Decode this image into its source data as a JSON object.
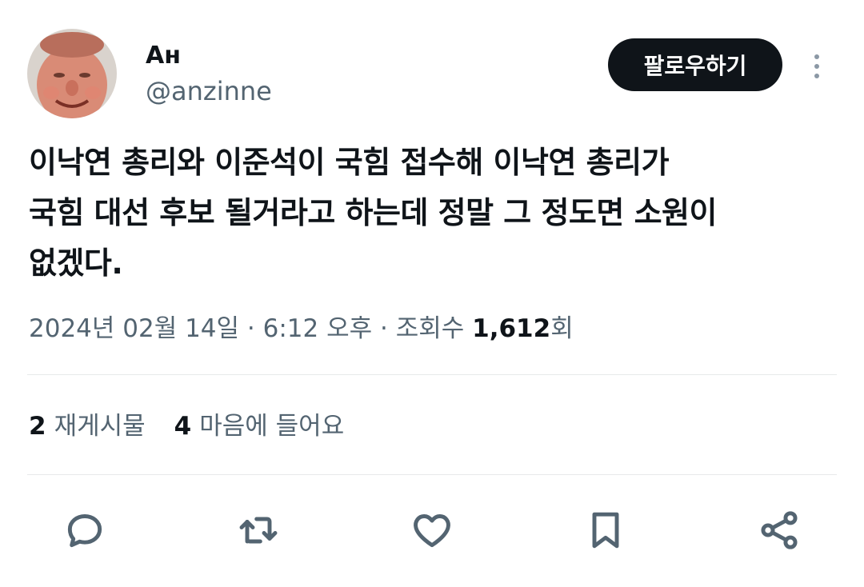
{
  "author": {
    "display_name": "Ан",
    "handle": "@anzinne",
    "avatar_icon": "user-avatar-photo"
  },
  "header": {
    "follow_label": "팔로우하기",
    "more_icon": "more-vertical-icon"
  },
  "tweet": {
    "text": "이낙연 총리와 이준석이 국힘 접수해 이낙연 총리가\n국힘 대선 후보 될거라고 하는데 정말 그 정도면 소원이\n없겠다."
  },
  "meta": {
    "date": "2024년 02월 14일",
    "separator1": " · ",
    "time": "6:12 오후",
    "separator2": " · ",
    "views_label": "조회수 ",
    "views_count": "1,612",
    "views_suffix": "회"
  },
  "stats": {
    "reposts_count": "2",
    "reposts_label": "재게시물",
    "likes_count": "4",
    "likes_label": "마음에 들어요"
  },
  "actions": {
    "reply_icon": "reply-icon",
    "repost_icon": "repost-icon",
    "like_icon": "heart-icon",
    "bookmark_icon": "bookmark-icon",
    "share_icon": "share-icon"
  },
  "colors": {
    "text": "#0f1419",
    "secondary": "#536471",
    "divider": "#e7e9ea",
    "button_bg": "#0f1419",
    "button_text": "#ffffff"
  }
}
